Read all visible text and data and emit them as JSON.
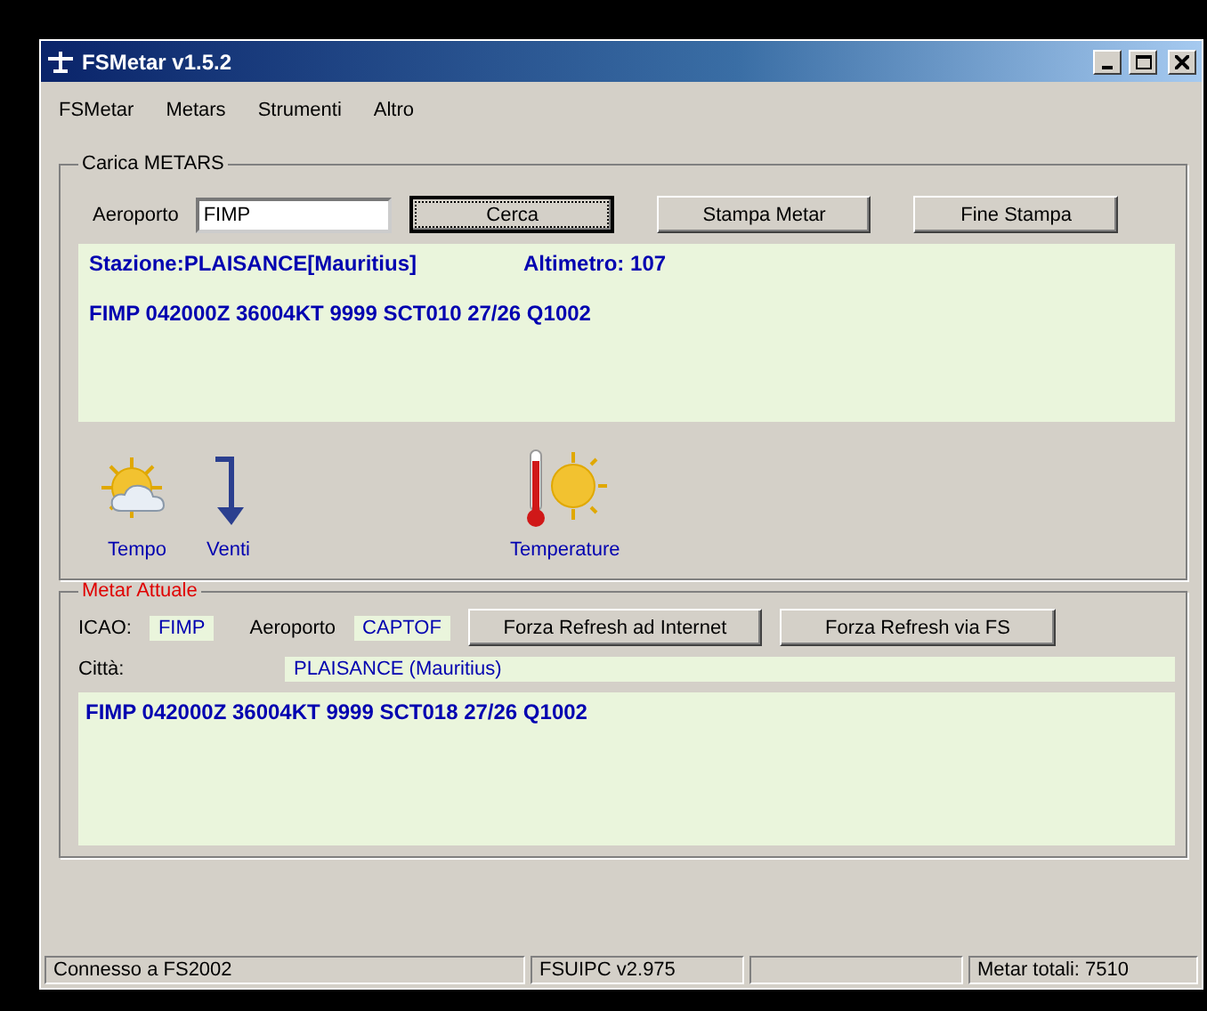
{
  "window": {
    "title": "FSMetar v1.5.2"
  },
  "menu": [
    "FSMetar",
    "Metars",
    "Strumenti",
    "Altro"
  ],
  "load_group": {
    "title": "Carica METARS",
    "airport_label": "Aeroporto",
    "airport_value": "FIMP",
    "buttons": [
      {
        "label": "Cerca",
        "focused": true
      },
      {
        "label": "Stampa Metar",
        "focused": false
      },
      {
        "label": "Fine Stampa",
        "focused": false
      }
    ],
    "station": "Stazione:PLAISANCE[Mauritius]",
    "altimeter": "Altimetro: 107",
    "metar": "FIMP 042000Z 36004KT 9999 SCT010 27/26 Q1002"
  },
  "weather_icons": [
    {
      "kind": "weather",
      "label": "Tempo"
    },
    {
      "kind": "wind",
      "label": "Venti"
    },
    {
      "kind": "temperature",
      "label": "Temperature"
    }
  ],
  "current_group": {
    "title": "Metar Attuale",
    "icao_label": "ICAO:",
    "icao_value": "FIMP",
    "airport_label": "Aeroporto",
    "airport_value": "CAPTOF",
    "buttons": [
      "Forza Refresh ad Internet",
      "Forza Refresh via FS"
    ],
    "city_label": "Città:",
    "city_value": "PLAISANCE (Mauritius)",
    "metar": "FIMP 042000Z 36004KT 9999 SCT018 27/26 Q1002"
  },
  "status_bar": [
    "Connesso a FS2002",
    "FSUIPC v2.975",
    "Metar totali: 7510"
  ]
}
